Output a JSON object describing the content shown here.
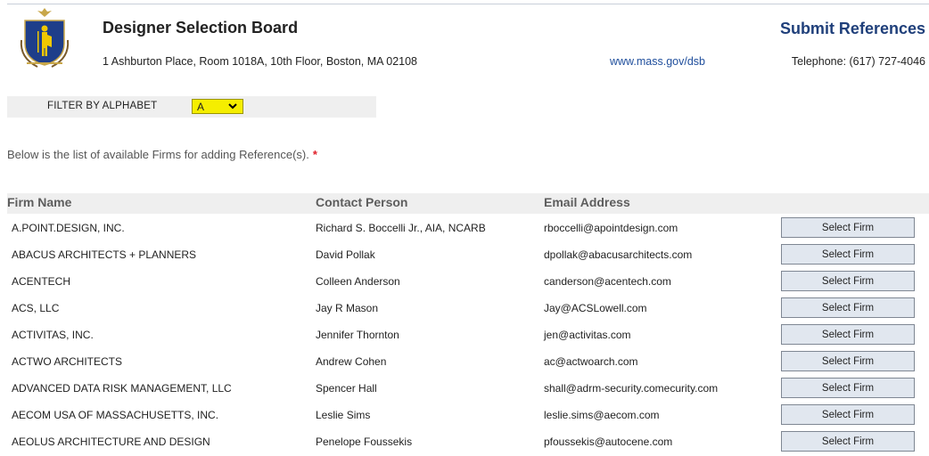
{
  "header": {
    "org_title": "Designer Selection Board",
    "address": "1 Ashburton Place, Room 1018A, 10th Floor, Boston, MA 02108",
    "website": "www.mass.gov/dsb",
    "page_title": "Submit References",
    "telephone": "Telephone: (617) 727-4046",
    "logo_icon": "massachusetts-seal-icon"
  },
  "filter": {
    "label": "FILTER BY ALPHABET",
    "selected": "A",
    "highlight_color": "#f5ee00"
  },
  "intro": {
    "text": "Below is the list of available Firms for adding Reference(s).",
    "required_marker": "*"
  },
  "table": {
    "columns": {
      "firm": "Firm Name",
      "contact": "Contact Person",
      "email": "Email Address"
    },
    "rows": [
      {
        "firm": "A.POINT.DESIGN, INC.",
        "contact": "Richard S. Boccelli Jr., AIA, NCARB",
        "email": "rboccelli@apointdesign.com",
        "action": "Select Firm"
      },
      {
        "firm": "ABACUS ARCHITECTS + PLANNERS",
        "contact": "David Pollak",
        "email": "dpollak@abacusarchitects.com",
        "action": "Select Firm"
      },
      {
        "firm": "ACENTECH",
        "contact": "Colleen Anderson",
        "email": "canderson@acentech.com",
        "action": "Select Firm"
      },
      {
        "firm": "ACS, LLC",
        "contact": "Jay R Mason",
        "email": "Jay@ACSLowell.com",
        "action": "Select Firm"
      },
      {
        "firm": "ACTIVITAS, INC.",
        "contact": "Jennifer Thornton",
        "email": "jen@activitas.com",
        "action": "Select Firm"
      },
      {
        "firm": "ACTWO ARCHITECTS",
        "contact": "Andrew Cohen",
        "email": "ac@actwoarch.com",
        "action": "Select Firm"
      },
      {
        "firm": "ADVANCED DATA RISK MANAGEMENT, LLC",
        "contact": "Spencer Hall",
        "email": "shall@adrm-security.comecurity.com",
        "action": "Select Firm"
      },
      {
        "firm": "AECOM USA OF MASSACHUSETTS, INC.",
        "contact": "Leslie Sims",
        "email": "leslie.sims@aecom.com",
        "action": "Select Firm"
      },
      {
        "firm": "AEOLUS ARCHITECTURE AND DESIGN",
        "contact": "Penelope Foussekis",
        "email": "pfoussekis@autocene.com",
        "action": "Select Firm"
      }
    ]
  },
  "colors": {
    "title_blue": "#1f3f7a",
    "link_blue": "#1f4e9c",
    "required_red": "#e0202a",
    "button_bg": "#e1e7ef"
  }
}
